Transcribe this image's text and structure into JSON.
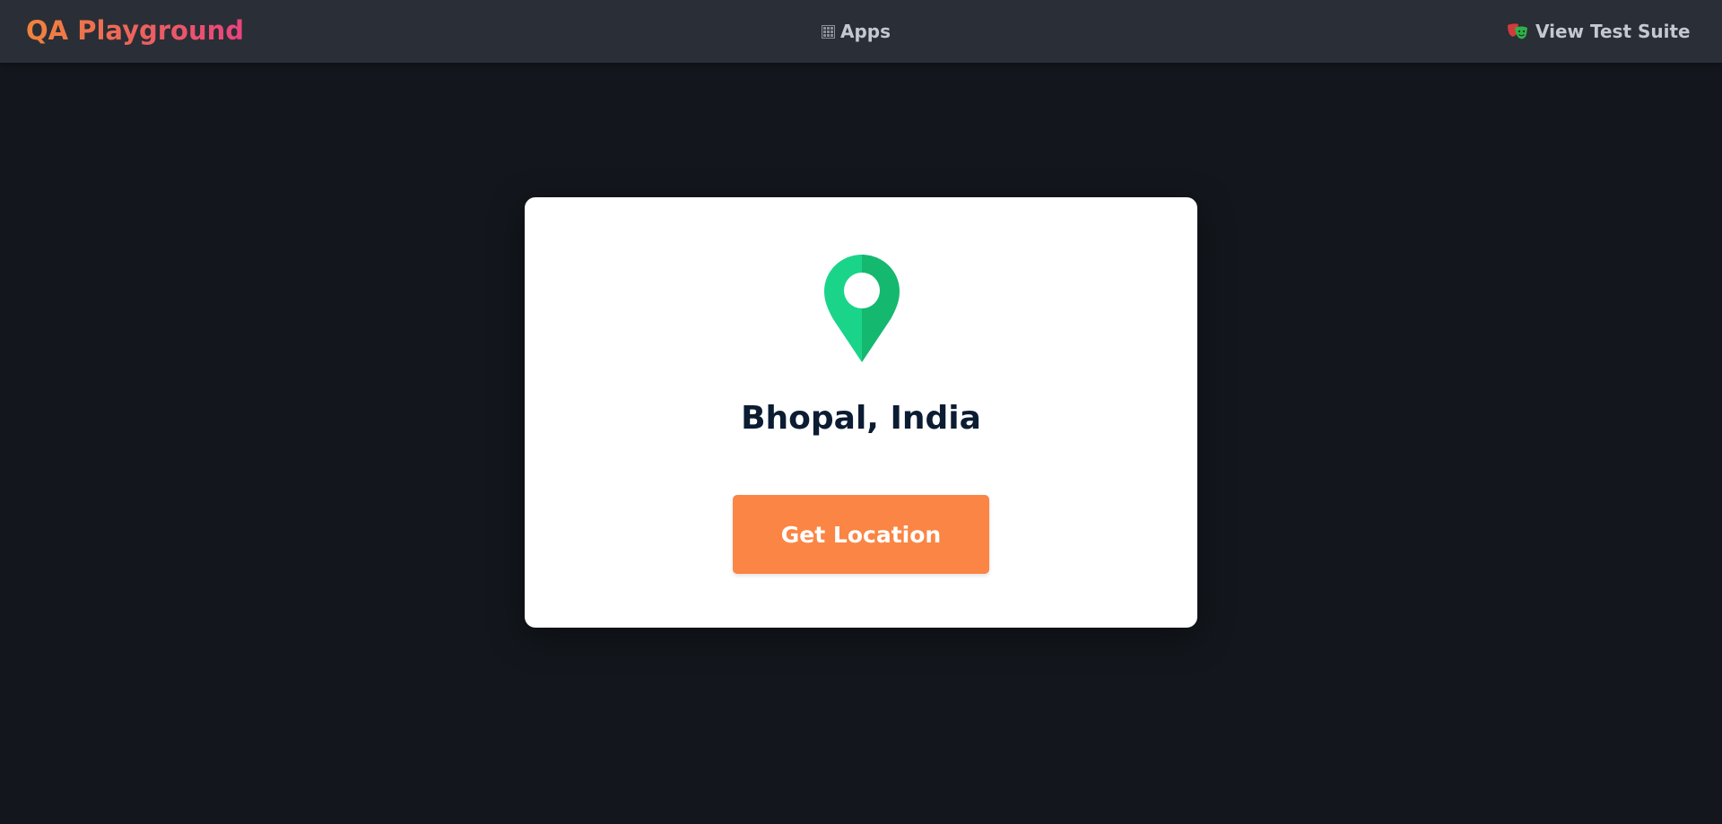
{
  "navbar": {
    "brand": "QA Playground",
    "apps_label": "Apps",
    "apps_icon": "grid-icon",
    "suite_label": "View Test Suite",
    "suite_icon": "theater-mask-icon"
  },
  "card": {
    "pin_icon": "map-pin-icon",
    "location": "Bhopal, India",
    "button_label": "Get Location"
  },
  "colors": {
    "page_bg": "#13171d",
    "navbar_bg": "#2a2e36",
    "brand_gradient_start": "#f0843c",
    "brand_gradient_end": "#e9437d",
    "pin_green": "#17c27a",
    "button_orange": "#fb8544",
    "location_text": "#0c1c33"
  }
}
